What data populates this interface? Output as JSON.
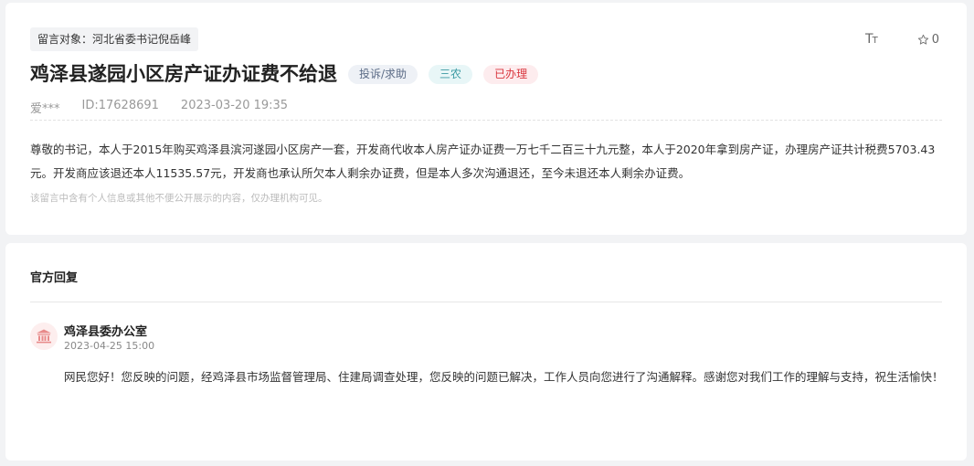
{
  "message": {
    "target": "留言对象：河北省委书记倪岳峰",
    "title": "鸡泽县遂园小区房产证办证费不给退",
    "tags": {
      "type": "投诉/求助",
      "category": "三农",
      "status": "已办理"
    },
    "author": "爱***",
    "id": "ID:17628691",
    "time": "2023-03-20 19:35",
    "content": "尊敬的书记，本人于2015年购买鸡泽县滨河遂园小区房产一套，开发商代收本人房产证办证费一万七千二百三十九元整，本人于2020年拿到房产证，办理房产证共计税费5703.43元。开发商应该退还本人11535.57元，开发商也承认所欠本人剩余办证费，但是本人多次沟通退还，至今未退还本人剩余办证费。",
    "privacy_note": "该留言中含有个人信息或其他不便公开展示的内容，仅办理机构可见。"
  },
  "tools": {
    "font_size_label": "Tт",
    "star_count": "0"
  },
  "reply": {
    "heading": "官方回复",
    "department": "鸡泽县委办公室",
    "time": "2023-04-25 15:00",
    "content": "网民您好！您反映的问题，经鸡泽县市场监督管理局、住建局调查处理，您反映的问题已解决，工作人员向您进行了沟通解释。感谢您对我们工作的理解与支持，祝生活愉快！"
  },
  "colors": {
    "status_red": "#d9363e",
    "category_teal": "#3b9aa3",
    "type_gray": "#5a6a85"
  },
  "icons": [
    "star-icon",
    "government-building-icon",
    "font-size-icon"
  ]
}
